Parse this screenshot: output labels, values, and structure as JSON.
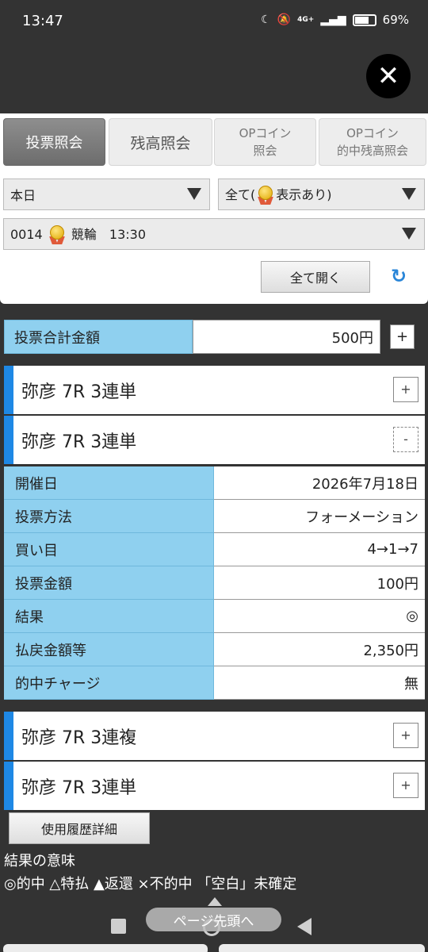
{
  "status": {
    "time": "13:47",
    "net": "4G+",
    "battery": "69%",
    "battery_level": 0.69
  },
  "tabs": [
    {
      "label": "投票照会"
    },
    {
      "label": "残高照会"
    },
    {
      "line1": "OPコイン",
      "line2": "照会"
    },
    {
      "line1": "OPコイン",
      "line2": "的中残高照会"
    }
  ],
  "filters": {
    "period": "本日",
    "display_prefix": "全て(",
    "display_suffix": "表示あり)",
    "race_code": "0014",
    "race_text": "競輪　13:30"
  },
  "open_all_label": "全て開く",
  "total": {
    "label": "投票合計金額",
    "value": "500円",
    "toggle": "+"
  },
  "bets": [
    {
      "title": "弥彦 7R 3連単",
      "toggle": "+"
    },
    {
      "title": "弥彦 7R 3連単",
      "toggle": "-"
    },
    {
      "title": "弥彦 7R 3連複",
      "toggle": "+"
    },
    {
      "title": "弥彦 7R 3連単",
      "toggle": "+"
    }
  ],
  "details": [
    {
      "label": "開催日",
      "value": "2026年7月18日"
    },
    {
      "label": "投票方法",
      "value": "フォーメーション"
    },
    {
      "label": "買い目",
      "value": "4→1→7"
    },
    {
      "label": "投票金額",
      "value": "100円"
    },
    {
      "label": "結果",
      "value": "◎"
    },
    {
      "label": "払戻金額等",
      "value": "2,350円"
    },
    {
      "label": "的中チャージ",
      "value": "無"
    }
  ],
  "history_button": "使用履歴詳細",
  "legend": {
    "title": "結果の意味",
    "text": "◎的中 △特払 ▲返還 ×不的中 「空白」未確定"
  },
  "page_top_label": "ページ先頭へ"
}
